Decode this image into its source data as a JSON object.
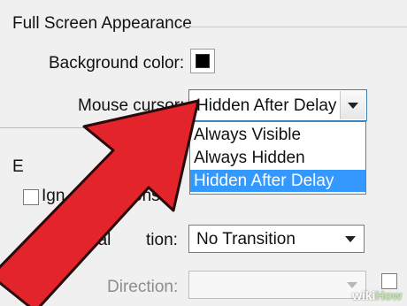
{
  "section_title": "Full Screen Appearance",
  "background_color": {
    "label": "Background color:",
    "value": "#000000"
  },
  "mouse_cursor": {
    "label": "Mouse cursor:",
    "selected": "Hidden After Delay",
    "options": [
      "Always Visible",
      "Always Hidden",
      "Hidden After Delay"
    ]
  },
  "partial_section_letter": "E",
  "ignore_checkbox": {
    "label_start": "Ign",
    "label_end": "ons"
  },
  "transition": {
    "label_start": "ual",
    "label_end": "tion:",
    "selected": "No Transition"
  },
  "direction": {
    "label": "Direction:",
    "value": ""
  },
  "watermark": {
    "wiki": "wiki",
    "how": "How"
  },
  "colors": {
    "highlight": "#3399ff",
    "arrow": "#e3242b"
  }
}
